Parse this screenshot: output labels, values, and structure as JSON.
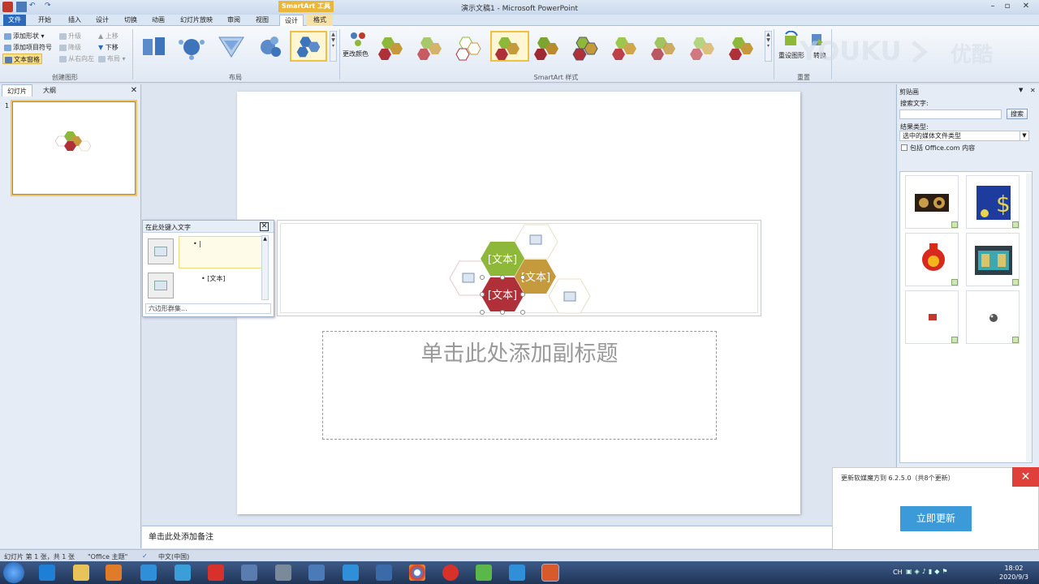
{
  "window": {
    "title": "演示文稿1 - Microsoft PowerPoint",
    "minimize": "–",
    "maximize": "▫",
    "close": "✕"
  },
  "contextual_tab_group": "SmartArt 工具",
  "tabs": [
    "文件",
    "开始",
    "插入",
    "设计",
    "切换",
    "动画",
    "幻灯片放映",
    "审阅",
    "视图",
    "设计",
    "格式"
  ],
  "ribbon": {
    "create_graphic": {
      "add_shape": "添加形状 ▾",
      "add_bullet": "添加项目符号",
      "text_pane": "文本窗格",
      "promote": "升级",
      "demote": "降级",
      "right_to_left": "从右向左",
      "move_up": "上移",
      "move_down": "下移",
      "layout": "布局 ▾",
      "label": "创建图形"
    },
    "layouts_label": "布局",
    "change_colors": "更改颜色",
    "styles_label": "SmartArt 样式",
    "reset_graphic": "重设图形",
    "convert": "转换",
    "reset_label": "重置"
  },
  "left_pane": {
    "tab_slides": "幻灯片",
    "tab_outline": "大纲",
    "close": "✕",
    "slide_number": "1"
  },
  "text_pane": {
    "title": "在此处键入文字",
    "close": "✕",
    "item1": "• |",
    "item2": "• [文本]",
    "footer": "六边形群集..."
  },
  "smartart": {
    "labels": [
      "[文本]",
      "[文本]",
      "[文本]"
    ],
    "colors": {
      "green": "#8db83a",
      "gold": "#c49a3c",
      "red": "#b0303a"
    }
  },
  "slide": {
    "subtitle_placeholder": "单击此处添加副标题"
  },
  "notes": {
    "placeholder": "单击此处添加备注"
  },
  "clip_art": {
    "title": "剪贴画",
    "search_label": "搜索文字:",
    "search_value": "",
    "search_button": "搜索",
    "result_types_label": "结果类型:",
    "result_types_value": "选中的媒体文件类型",
    "include_office": "包括 Office.com 内容"
  },
  "update_popup": {
    "message": "更新软媒魔方到 6.2.5.0（共8个更新）",
    "button": "立即更新",
    "close": "✕"
  },
  "status": {
    "slide_info": "幻灯片 第 1 张，共 1 张",
    "theme": "\"Office 主题\"",
    "language": "中文(中国)"
  },
  "taskbar": {
    "time": "18:02",
    "date": "2020/9/3",
    "input": "CH"
  },
  "watermark": "YOUKU 优酷"
}
